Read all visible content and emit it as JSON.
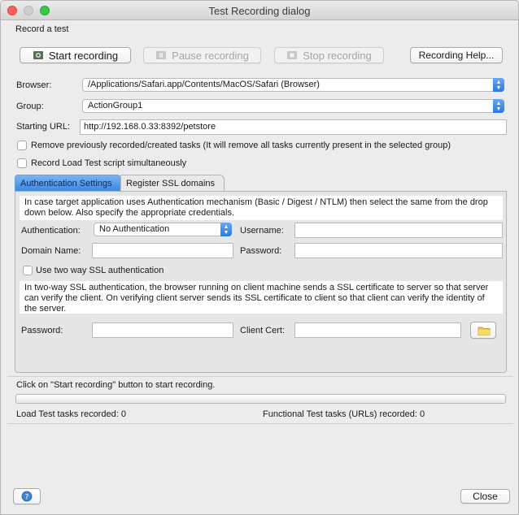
{
  "window": {
    "title": "Test Recording dialog"
  },
  "section_title": "Record a test",
  "toolbar": {
    "start_label": "Start recording",
    "pause_label": "Pause recording",
    "stop_label": "Stop recording",
    "help_label": "Recording Help..."
  },
  "form": {
    "browser_label": "Browser:",
    "browser_value": "/Applications/Safari.app/Contents/MacOS/Safari (Browser)",
    "group_label": "Group:",
    "group_value": "ActionGroup1",
    "url_label": "Starting URL:",
    "url_value": "http://192.168.0.33:8392/petstore",
    "remove_label": "Remove previously recorded/created tasks (It will remove all tasks currently present in the selected group)",
    "loadtest_label": "Record Load Test script simultaneously"
  },
  "tabs": [
    {
      "label": "Authentication Settings"
    },
    {
      "label": "Register SSL domains"
    }
  ],
  "auth": {
    "info": "In case target application uses Authentication mechanism (Basic / Digest / NTLM) then select the same from the drop down below. Also specify the appropriate credentials.",
    "auth_label": "Authentication:",
    "auth_value": "No Authentication",
    "username_label": "Username:",
    "username_value": "",
    "domain_label": "Domain Name:",
    "domain_value": "",
    "password_label": "Password:",
    "password_value": "",
    "twoway_label": "Use two way SSL authentication",
    "ssl_info": "In two-way SSL authentication, the browser running on client machine sends a SSL certificate to server so that server can verify the client. On verifying client server sends its SSL certificate to client so that client can verify the identity of the server.",
    "ssl_password_label": "Password:",
    "ssl_password_value": "",
    "client_cert_label": "Client Cert:",
    "client_cert_value": ""
  },
  "status": {
    "message": "Click on \"Start recording\" button to start recording.",
    "load_count": "Load Test tasks recorded: 0",
    "functional_count": "Functional Test tasks (URLs) recorded: 0"
  },
  "footer": {
    "close_label": "Close"
  }
}
